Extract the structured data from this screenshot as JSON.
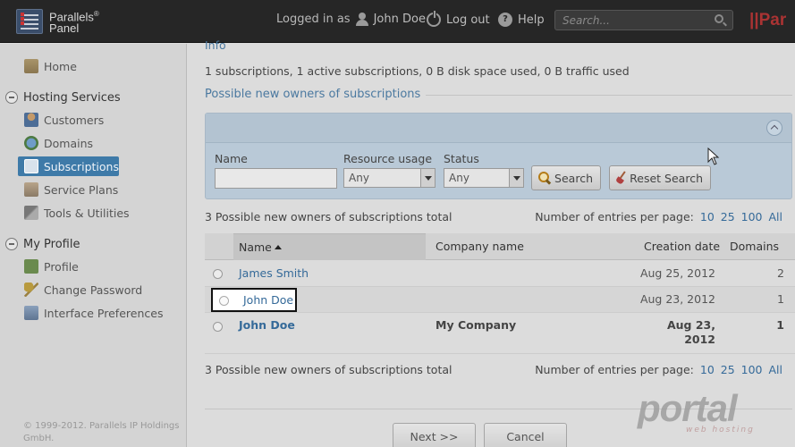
{
  "topbar": {
    "logo_line1": "Parallels",
    "logo_reg": "®",
    "logo_line2": "Panel",
    "logged_in_as": "Logged in as",
    "user_name": "John Doe",
    "logout_label": "Log out",
    "help_label": "Help",
    "search_placeholder": "Search...",
    "brand_right": "||Par"
  },
  "sidebar": {
    "home": "Home",
    "hosting_services": "Hosting Services",
    "items": [
      {
        "label": "Customers",
        "icon": "customers-icon"
      },
      {
        "label": "Domains",
        "icon": "globe-icon"
      },
      {
        "label": "Subscriptions",
        "icon": "subscriptions-icon",
        "active": true
      },
      {
        "label": "Service Plans",
        "icon": "service-plans-icon"
      },
      {
        "label": "Tools & Utilities",
        "icon": "tools-icon"
      }
    ],
    "my_profile": "My Profile",
    "profile_items": [
      {
        "label": "Profile",
        "icon": "profile-icon"
      },
      {
        "label": "Change Password",
        "icon": "key-icon"
      },
      {
        "label": "Interface Preferences",
        "icon": "preferences-icon"
      }
    ],
    "copyright": "© 1999-2012. Parallels IP Holdings GmbH."
  },
  "main": {
    "info_heading": "Info",
    "summary": "1 subscriptions, 1 active subscriptions, 0 B disk space used, 0 B traffic used",
    "section_title": "Possible new owners of subscriptions",
    "filter": {
      "name_label": "Name",
      "name_value": "",
      "resource_label": "Resource usage",
      "resource_value": "Any",
      "status_label": "Status",
      "status_value": "Any",
      "search_button": "Search",
      "reset_button": "Reset Search"
    },
    "total_text": "3 Possible new owners of subscriptions total",
    "per_page_label": "Number of entries per page:",
    "per_page_options": [
      "10",
      "25",
      "100",
      "All"
    ],
    "columns": {
      "name": "Name",
      "company": "Company name",
      "creation_date": "Creation date",
      "domains": "Domains"
    },
    "rows": [
      {
        "name": "James Smith",
        "company": "",
        "date": "Aug 25, 2012",
        "domains": "2"
      },
      {
        "name": "John Doe",
        "company": "",
        "date": "Aug 23, 2012",
        "domains": "1"
      },
      {
        "name": "John Doe",
        "company": "My Company",
        "date": "Aug 23, 2012",
        "domains": "1"
      }
    ],
    "next_button": "Next >>",
    "cancel_button": "Cancel"
  },
  "watermark": {
    "text": "portal",
    "sub": "web hosting"
  }
}
